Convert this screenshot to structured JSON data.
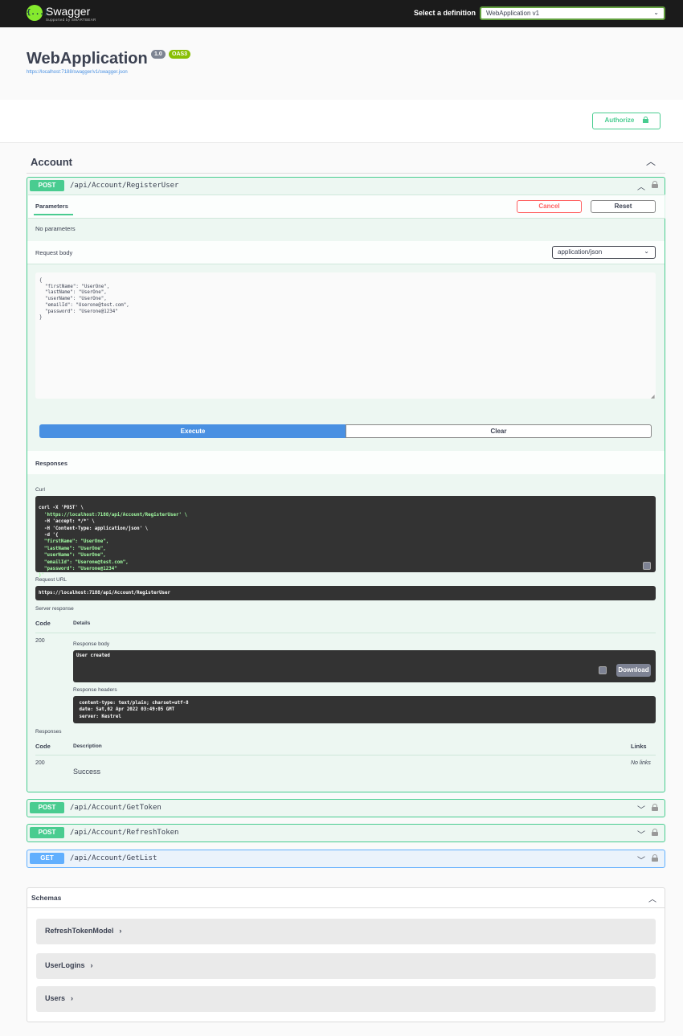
{
  "topbar": {
    "brand": "Swagger",
    "brand_sub": "Supported by SMARTBEAR",
    "logo_glyph": "{...}",
    "definition_label": "Select a definition",
    "definition_value": "WebApplication v1"
  },
  "info": {
    "title": "WebApplication",
    "version": "1.0",
    "oas": "OAS3",
    "url": "https://localhost:7188/swagger/v1/swagger.json"
  },
  "authorize_label": "Authorize",
  "tag": {
    "name": "Account"
  },
  "operations": [
    {
      "method": "POST",
      "path": "/api/Account/RegisterUser"
    },
    {
      "method": "POST",
      "path": "/api/Account/GetToken"
    },
    {
      "method": "POST",
      "path": "/api/Account/RefreshToken"
    },
    {
      "method": "GET",
      "path": "/api/Account/GetList"
    }
  ],
  "expanded": {
    "tab_parameters": "Parameters",
    "cancel": "Cancel",
    "reset": "Reset",
    "no_params": "No parameters",
    "request_body": "Request body",
    "content_type": "application/json",
    "body_text": "{\n  \"firstName\": \"UserOne\",\n  \"lastName\": \"UserOne\",\n  \"userName\": \"UserOne\",\n  \"emailId\": \"Userone@test.com\",\n  \"password\": \"Userone@1234\"\n}",
    "execute": "Execute",
    "clear": "Clear",
    "responses_header": "Responses",
    "curl_label": "Curl",
    "curl_lines": [
      "curl -X 'POST' \\",
      "  'https://localhost:7188/api/Account/RegisterUser' \\",
      "  -H 'accept: */*' \\",
      "  -H 'Content-Type: application/json' \\",
      "  -d '{",
      "  \"firstName\": \"UserOne\",",
      "  \"lastName\": \"UserOne\",",
      "  \"userName\": \"UserOne\",",
      "  \"emailId\": \"Userone@test.com\",",
      "  \"password\": \"Userone@1234\"",
      "}'"
    ],
    "request_url_label": "Request URL",
    "request_url": "https://localhost:7188/api/Account/RegisterUser",
    "server_response_label": "Server response",
    "code_header": "Code",
    "details_header": "Details",
    "code": "200",
    "response_body_label": "Response body",
    "response_body": "User created",
    "download": "Download",
    "response_headers_label": "Response headers",
    "response_headers": " content-type: text/plain; charset=utf-8\n date: Sat,02 Apr 2022 03:49:05 GMT\n server: Kestrel",
    "responses_label": "Responses",
    "description_header": "Description",
    "links_header": "Links",
    "success_code": "200",
    "success_desc": "Success",
    "no_links": "No links"
  },
  "schemas": {
    "title": "Schemas",
    "models": [
      "RefreshTokenModel",
      "UserLogins",
      "Users"
    ]
  },
  "colors": {
    "post": "#49cc90",
    "get": "#61affe",
    "execute": "#4990e2",
    "cancel": "#ff6060"
  }
}
